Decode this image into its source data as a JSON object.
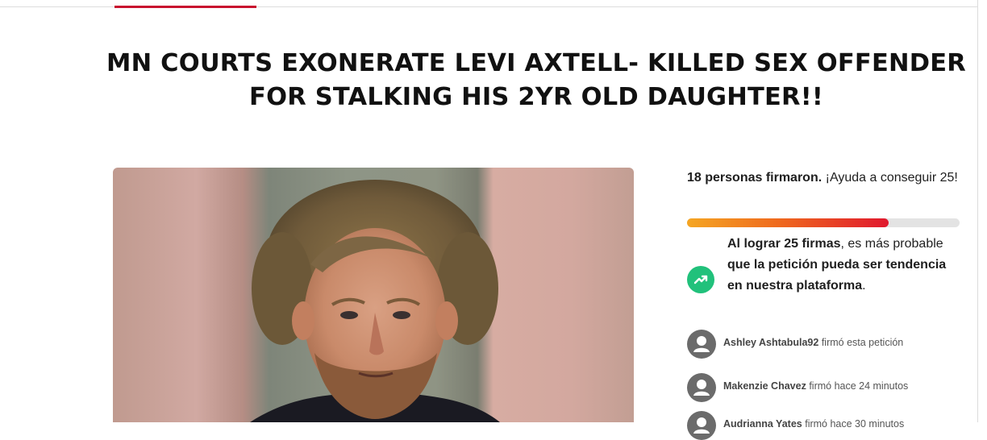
{
  "petition": {
    "title": "MN COURTS EXONERATE LEVI AXTELL- KILLED SEX OFFENDER FOR STALKING HIS 2YR OLD DAUGHTER!!"
  },
  "signatures": {
    "count_text": "18 personas firmaron.",
    "help_text": " ¡Ayuda a conseguir 25!",
    "current": 18,
    "goal": 25,
    "progress_fraction": 0.74
  },
  "trend": {
    "icon": "trending-up-icon",
    "part1": "Al lograr 25 firmas",
    "part2": ", es más probable ",
    "part3": "que la petición pueda ser tendencia en nuestra plataforma",
    "part4": "."
  },
  "signers": [
    {
      "name": "Ashley Ashtabula92",
      "action": "firmó esta petición"
    },
    {
      "name": "Makenzie Chavez",
      "action": "firmó hace 24 minutos"
    },
    {
      "name": "Audrianna Yates",
      "action": "firmó hace 30 minutos"
    }
  ],
  "colors": {
    "accent_red": "#c8102e",
    "progress_start": "#f5a623",
    "progress_end": "#e0182e",
    "trend_green": "#21c17b",
    "avatar_gray": "#6b6b6b"
  }
}
